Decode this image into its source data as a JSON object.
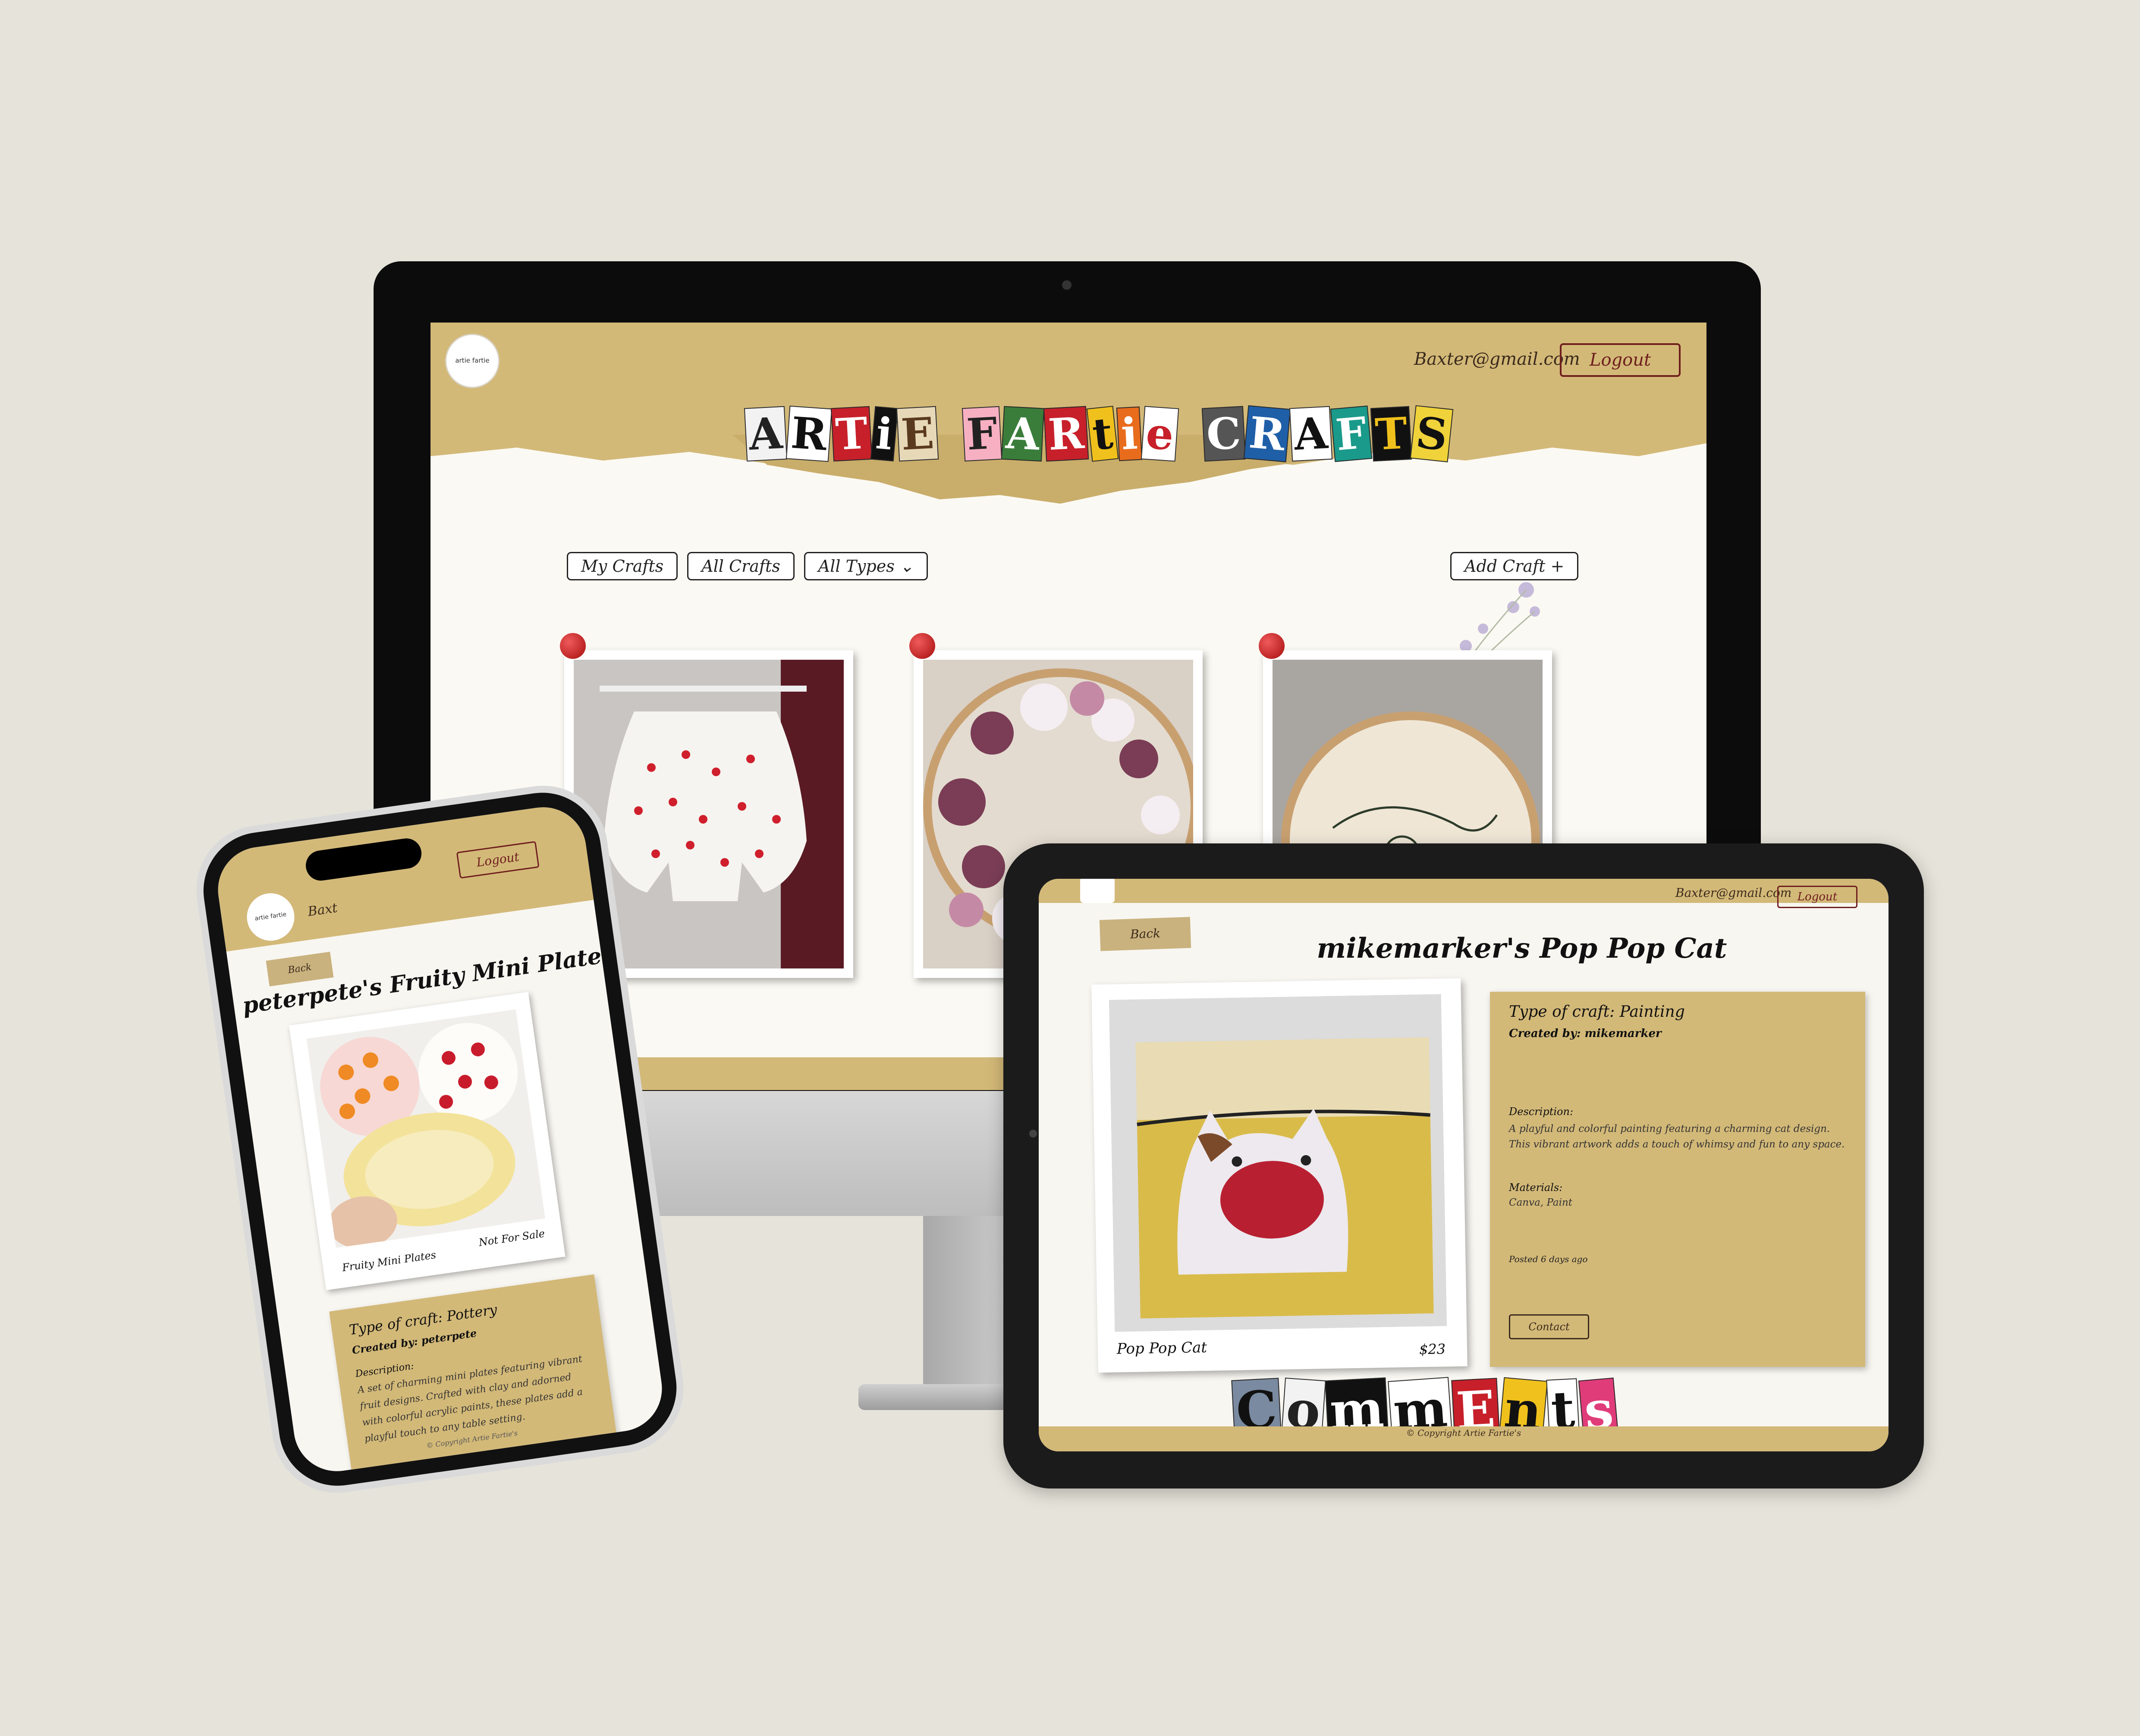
{
  "desktop": {
    "logo_text": "artie fartie",
    "user_email": "Baxter@gmail.com",
    "logout_label": "Logout",
    "title_letters": [
      "A",
      "R",
      "T",
      "i",
      "E",
      " ",
      "F",
      "A",
      "R",
      "t",
      "i",
      "e",
      " ",
      "C",
      "R",
      "A",
      "F",
      "T",
      "S"
    ],
    "filters": {
      "my_crafts": "My Crafts",
      "all_crafts": "All Crafts",
      "all_types": "All Types"
    },
    "add_craft_label": "Add Craft +"
  },
  "tablet": {
    "user_email": "Baxter@gmail.com",
    "logout_label": "Logout",
    "back_label": "Back",
    "page_title": "mikemarker's Pop Pop Cat",
    "photo_caption": "Pop Pop Cat",
    "price": "$23",
    "type_of_craft": "Type of craft: Painting",
    "created_by": "Created by: mikemarker",
    "description_label": "Description:",
    "description": "A playful and colorful painting featuring a charming cat design. This vibrant artwork adds a touch of whimsy and fun to any space.",
    "materials_label": "Materials:",
    "materials": "Canva, Paint",
    "posted": "Posted 6 days ago",
    "contact_label": "Contact",
    "comments_letters": [
      "C",
      "o",
      "m",
      "m",
      "E",
      "n",
      "t",
      "s"
    ],
    "copyright": "© Copyright Artie Fartie's"
  },
  "phone": {
    "logo_text": "artie fartie",
    "user_email": "Baxt",
    "logout_label": "Logout",
    "back_label": "Back",
    "page_title": "peterpete's Fruity Mini Plates",
    "photo_caption": "Fruity Mini Plates",
    "sale_status": "Not For Sale",
    "type_of_craft": "Type of craft: Pottery",
    "created_by": "Created by: peterpete",
    "description_label": "Description:",
    "description": "A set of charming mini plates featuring vibrant fruit designs. Crafted with clay and adorned with colorful acrylic paints, these plates add a playful touch to any table setting.",
    "copyright": "© Copyright Artie Fartie's"
  },
  "colors": {
    "background": "#e6e3da",
    "kraft": "#d3b978",
    "logout_red": "#6e1d1d",
    "paper": "#fbf9f3"
  }
}
